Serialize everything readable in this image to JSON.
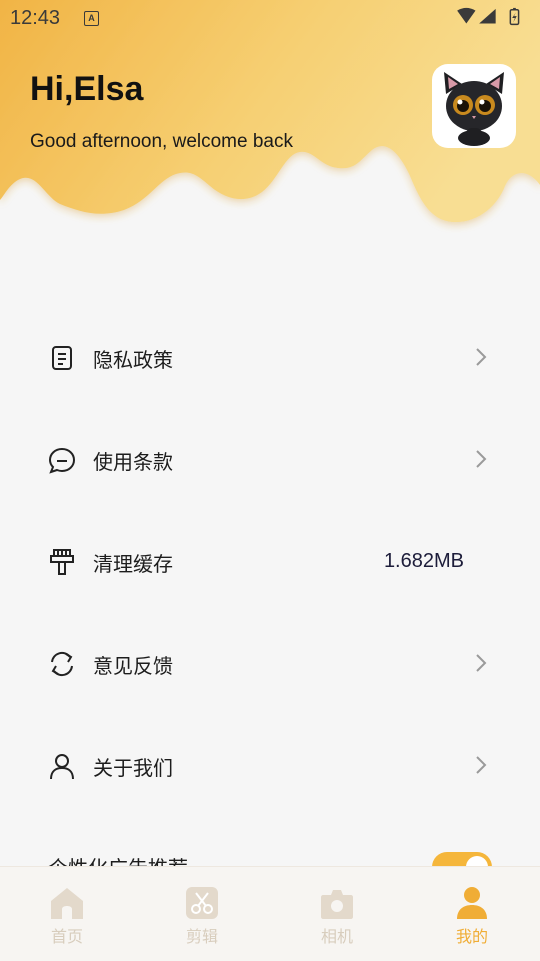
{
  "status_bar": {
    "time": "12:43",
    "badge": "A"
  },
  "header": {
    "greeting": "Hi,Elsa",
    "subtitle": "Good afternoon, welcome back",
    "avatar_icon": "black-cat-avatar"
  },
  "menu": {
    "items": [
      {
        "label": "隐私政策",
        "icon": "document-icon",
        "has_arrow": true
      },
      {
        "label": "使用条款",
        "icon": "chat-bubble-icon",
        "has_arrow": true
      },
      {
        "label": "清理缓存",
        "icon": "brush-icon",
        "value": "1.682MB",
        "has_arrow": false
      },
      {
        "label": "意见反馈",
        "icon": "refresh-icon",
        "has_arrow": true
      },
      {
        "label": "关于我们",
        "icon": "person-icon",
        "has_arrow": true
      }
    ],
    "ad_toggle": {
      "label": "个性化广告推荐",
      "on": true
    }
  },
  "tabbar": {
    "tabs": [
      {
        "label": "首页",
        "icon": "home-icon",
        "active": false
      },
      {
        "label": "剪辑",
        "icon": "scissors-icon",
        "active": false
      },
      {
        "label": "相机",
        "icon": "camera-icon",
        "active": false
      },
      {
        "label": "我的",
        "icon": "person-icon",
        "active": true
      }
    ]
  },
  "colors": {
    "accent": "#f0ad36",
    "header_gradient_start": "#f2b646",
    "header_gradient_end": "#f7dc8e",
    "background": "#f6f6f6"
  }
}
